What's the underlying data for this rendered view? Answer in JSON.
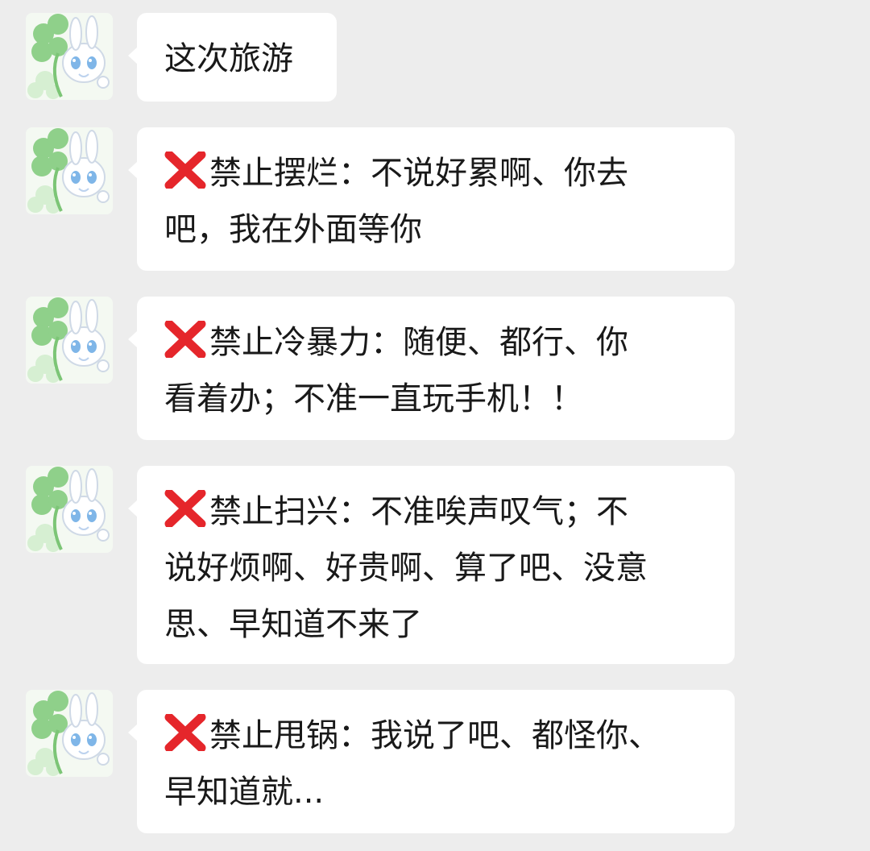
{
  "messages": [
    {
      "avatar": "clover-bunny-avatar",
      "has_mark": false,
      "lines": [
        "这次旅游"
      ]
    },
    {
      "avatar": "clover-bunny-avatar",
      "has_mark": true,
      "mark_icon": "red-x-icon",
      "lines": [
        "禁止摆烂：不说好累啊、你去",
        "吧，我在外面等你"
      ]
    },
    {
      "avatar": "clover-bunny-avatar",
      "has_mark": true,
      "mark_icon": "red-x-icon",
      "lines": [
        "禁止冷暴力：随便、都行、你",
        "看着办；不准一直玩手机！！"
      ]
    },
    {
      "avatar": "clover-bunny-avatar",
      "has_mark": true,
      "mark_icon": "red-x-icon",
      "lines": [
        "禁止扫兴：不准唉声叹气；不",
        "说好烦啊、好贵啊、算了吧、没意",
        "思、早知道不来了"
      ]
    },
    {
      "avatar": "clover-bunny-avatar",
      "has_mark": true,
      "mark_icon": "red-x-icon",
      "lines": [
        "禁止甩锅：我说了吧、都怪你、",
        "早知道就..."
      ]
    }
  ],
  "colors": {
    "background": "#ededed",
    "bubble": "#ffffff",
    "text": "#191919",
    "x_mark": "#e5262b",
    "clover": "#7cc576"
  }
}
